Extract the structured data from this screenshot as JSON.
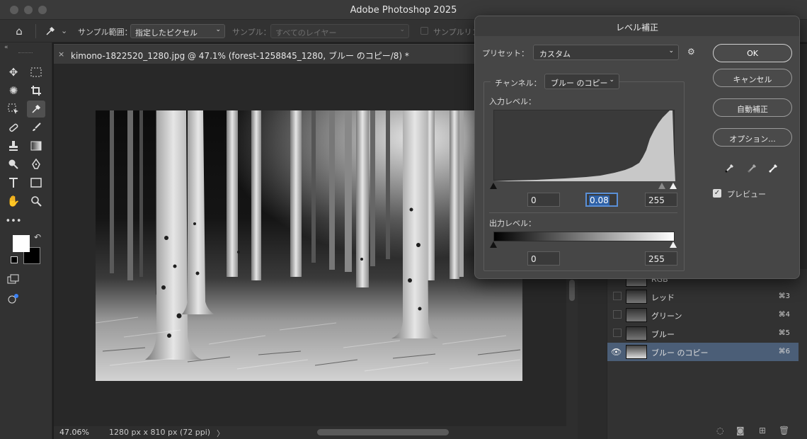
{
  "window": {
    "title": "Adobe Photoshop 2025"
  },
  "options_bar": {
    "sample_size_label": "サンプル範囲：",
    "sample_size_value": "指定したピクセル",
    "sample_label": "サンプル：",
    "sample_value": "すべてのレイヤー",
    "show_ring_label": "サンプルリン"
  },
  "document": {
    "tab_title": "kimono-1822520_1280.jpg @ 47.1% (forest-1258845_1280, ブルー のコピー/8) *",
    "close_glyph": "×"
  },
  "status": {
    "zoom": "47.06%",
    "dimensions": "1280 px x 810 px (72 ppi)",
    "arrow": "〉"
  },
  "levels_dialog": {
    "title": "レベル補正",
    "preset_label": "プリセット：",
    "preset_value": "カスタム",
    "channel_label": "チャンネル：",
    "channel_value": "ブルー のコピー",
    "input_label": "入力レベル：",
    "input_black": "0",
    "input_gamma": "0.08",
    "input_white": "255",
    "output_label": "出力レベル：",
    "output_black": "0",
    "output_white": "255",
    "buttons": {
      "ok": "OK",
      "cancel": "キャンセル",
      "auto": "自動補正",
      "options": "オプション..."
    },
    "preview_label": "プレビュー",
    "preview_checked": true
  },
  "channels": [
    {
      "name": "RGB",
      "key": ""
    },
    {
      "name": "レッド",
      "key": "⌘3"
    },
    {
      "name": "グリーン",
      "key": "⌘4"
    },
    {
      "name": "ブルー",
      "key": "⌘5"
    },
    {
      "name": "ブルー のコピー",
      "key": "⌘6"
    }
  ],
  "colors": {
    "foreground": "#ffffff",
    "background": "#000000",
    "selection": "#4b5e77",
    "focus": "#5a8fd6"
  }
}
